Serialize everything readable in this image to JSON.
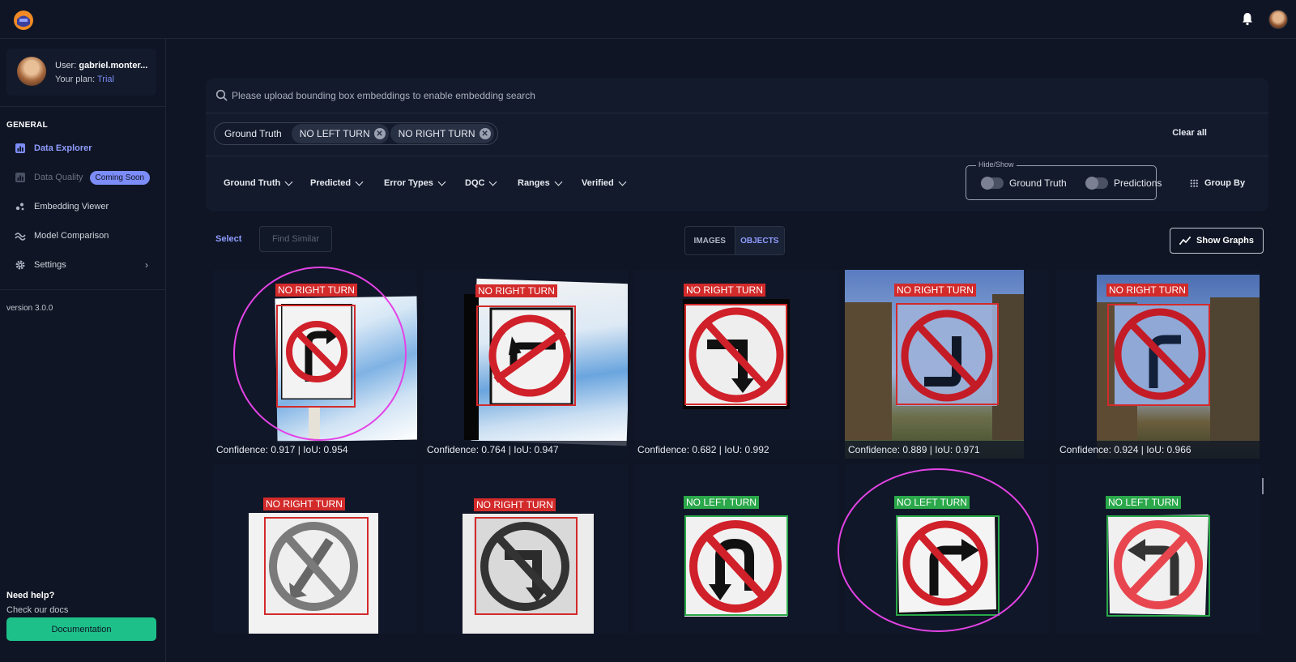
{
  "header": {
    "logo_icon": "helmet-logo-icon",
    "bell_icon": "bell-icon"
  },
  "sidebar": {
    "user_prefix": "User:",
    "user_name": "gabriel.monter...",
    "plan_prefix": "Your plan:",
    "plan_value": "Trial",
    "section_label": "GENERAL",
    "items": [
      {
        "label": "Data Explorer",
        "icon": "bar-chart-icon",
        "state": "active"
      },
      {
        "label": "Data Quality",
        "icon": "bar-chart-icon",
        "state": "disabled",
        "badge": "Coming Soon"
      },
      {
        "label": "Embedding Viewer",
        "icon": "scatter-icon",
        "state": "normal"
      },
      {
        "label": "Model Comparison",
        "icon": "wave-icon",
        "state": "normal"
      },
      {
        "label": "Settings",
        "icon": "gear-icon",
        "state": "normal"
      }
    ],
    "version": "version 3.0.0",
    "help_title": "Need help?",
    "help_sub": "Check our docs",
    "docs_button": "Documentation"
  },
  "search": {
    "placeholder": "Please upload bounding box embeddings to enable embedding search"
  },
  "chips": {
    "group_label": "Ground Truth",
    "values": [
      "NO LEFT TURN",
      "NO RIGHT TURN"
    ],
    "clear_all": "Clear all"
  },
  "filters": [
    "Ground Truth",
    "Predicted",
    "Error Types",
    "DQC",
    "Ranges",
    "Verified"
  ],
  "hide_show": {
    "legend": "Hide/Show",
    "ground_truth": "Ground Truth",
    "predictions": "Predictions"
  },
  "group_by": "Group By",
  "toolbar": {
    "select": "Select",
    "find_similar": "Find Similar",
    "view_images": "IMAGES",
    "view_objects": "OBJECTS",
    "active_view": "OBJECTS",
    "show_graphs": "Show Graphs"
  },
  "cards": [
    {
      "label": "NO RIGHT TURN",
      "label_color": "#d32a2a",
      "caption": "Confidence: 0.917 | IoU: 0.954",
      "highlighted": true
    },
    {
      "label": "NO RIGHT TURN",
      "label_color": "#d32a2a",
      "caption": "Confidence: 0.764 | IoU: 0.947",
      "highlighted": false
    },
    {
      "label": "NO RIGHT TURN",
      "label_color": "#d32a2a",
      "caption": "Confidence: 0.682 | IoU: 0.992",
      "highlighted": false
    },
    {
      "label": "NO RIGHT TURN",
      "label_color": "#d32a2a",
      "caption": "Confidence: 0.889 | IoU: 0.971",
      "highlighted": false
    },
    {
      "label": "NO RIGHT TURN",
      "label_color": "#d32a2a",
      "caption": "Confidence: 0.924 | IoU: 0.966",
      "highlighted": false
    },
    {
      "label": "NO RIGHT TURN",
      "label_color": "#d32a2a",
      "caption": "",
      "highlighted": false
    },
    {
      "label": "NO RIGHT TURN",
      "label_color": "#d32a2a",
      "caption": "",
      "highlighted": false
    },
    {
      "label": "NO LEFT TURN",
      "label_color": "#2aa84a",
      "caption": "",
      "highlighted": false
    },
    {
      "label": "NO LEFT TURN",
      "label_color": "#2aa84a",
      "caption": "",
      "highlighted": true
    },
    {
      "label": "NO LEFT TURN",
      "label_color": "#2aa84a",
      "caption": "",
      "highlighted": false
    }
  ]
}
